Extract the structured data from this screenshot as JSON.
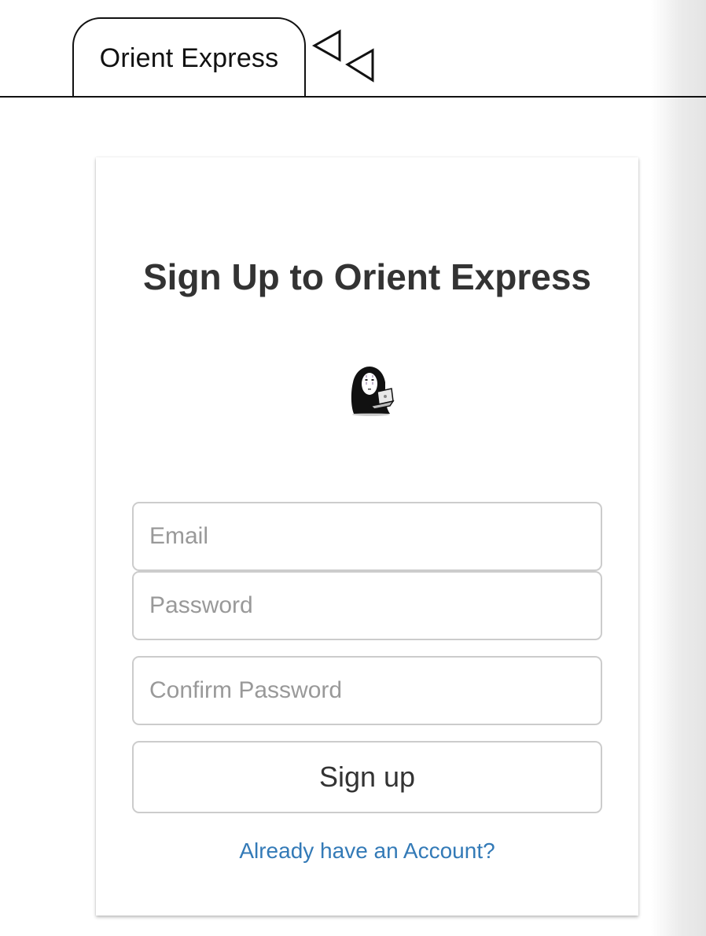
{
  "browser": {
    "tab_title": "Orient Express"
  },
  "signup": {
    "title": "Sign Up to Orient Express",
    "mascot_icon": "no-face-with-laptop-icon",
    "email_placeholder": "Email",
    "password_placeholder": "Password",
    "confirm_password_placeholder": "Confirm Password",
    "submit_label": "Sign up",
    "login_link": "Already have an Account?"
  },
  "colors": {
    "link": "#337ab7",
    "text": "#333333",
    "border": "#cccccc",
    "placeholder": "#999999"
  }
}
